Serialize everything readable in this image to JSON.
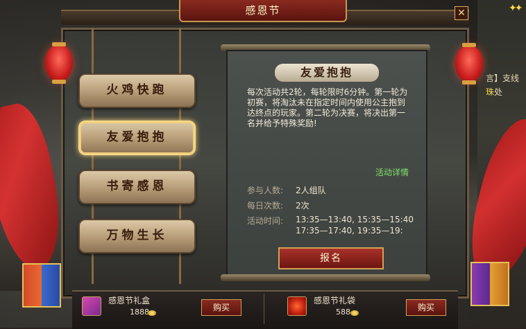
{
  "window": {
    "title": "感恩节"
  },
  "right_edge": {
    "line1_a": "言】支线",
    "line2_a": "珠",
    "line2_b": "处"
  },
  "menu": {
    "items": [
      {
        "label": "火鸡快跑",
        "active": false
      },
      {
        "label": "友爱抱抱",
        "active": true
      },
      {
        "label": "书寄感恩",
        "active": false
      },
      {
        "label": "万物生长",
        "active": false
      }
    ]
  },
  "activity": {
    "title": "友爱抱抱",
    "description": "每次活动共2轮，每轮限时6分钟。第一轮为初赛，将淘汰未在指定时间内使用公主抱到达终点的玩家。第二轮为决赛，将决出第一名并给予特殊奖励!",
    "detail_link": "活动详情",
    "participants_label": "参与人数:",
    "participants_value": "2人组队",
    "daily_label": "每日次数:",
    "daily_value": "2次",
    "time_label": "活动时间:",
    "time_value_1": "13:35—13:40, 15:35—15:40",
    "time_value_2": "17:35—17:40, 19:35—19:",
    "signup_label": "报名"
  },
  "shop": {
    "items": [
      {
        "name": "感恩节礼盒",
        "price": "1888",
        "buy_label": "购买",
        "icon": "gift-box-icon"
      },
      {
        "name": "感恩节礼袋",
        "price": "588",
        "buy_label": "购买",
        "icon": "gift-bag-icon"
      }
    ]
  },
  "colors": {
    "accent_red": "#a8322a",
    "gold_border": "#d4a058",
    "link_green": "#7fe36a",
    "plaque": "#c9b08a"
  }
}
